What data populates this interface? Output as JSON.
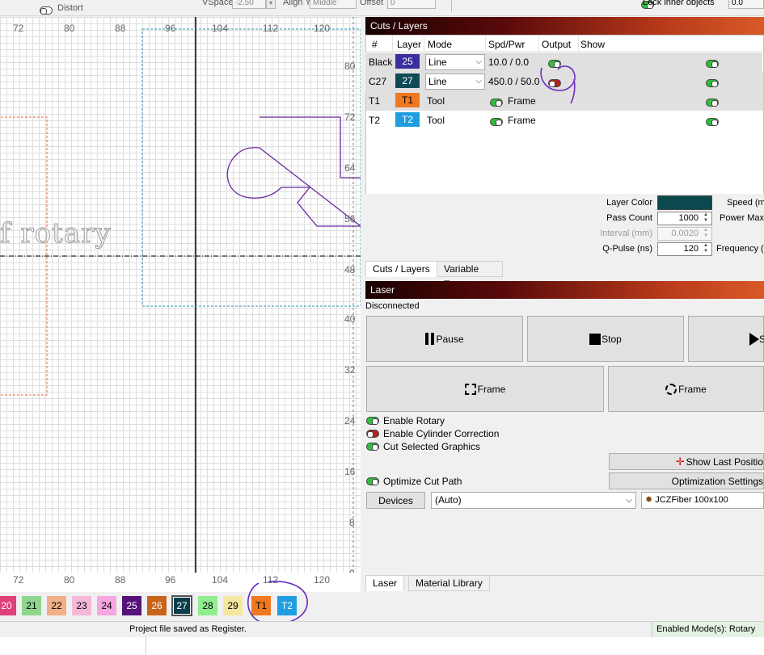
{
  "toolbar": {
    "distort_label": "Distort",
    "vspace_label": "VSpace",
    "vspace_value": "-2.50",
    "aligny_label": "Align Y",
    "aligny_value": "Middle",
    "offset_label": "Offset",
    "offset_value": "0",
    "lock_inner_label": "Lock inner objects",
    "right_value": "0.0"
  },
  "canvas": {
    "ruler_top": [
      "72",
      "80",
      "88",
      "96",
      "104",
      "112",
      "120"
    ],
    "ruler_bottom": [
      "72",
      "80",
      "88",
      "96",
      "104",
      "112",
      "120"
    ],
    "ruler_right": [
      "80",
      "72",
      "64",
      "56",
      "48",
      "40",
      "32",
      "24",
      "16",
      "8",
      "0"
    ],
    "text_object": "rotary"
  },
  "cuts_layers": {
    "title": "Cuts / Layers",
    "columns": [
      "#",
      "Layer",
      "Mode",
      "Spd/Pwr",
      "Output",
      "Show"
    ],
    "rows": [
      {
        "name": "Black",
        "layer": "25",
        "color": "#3a2f9e",
        "mode": "Line",
        "spdpwr": "10.0 / 0.0",
        "output": "on",
        "show": "on"
      },
      {
        "name": "C27",
        "layer": "27",
        "color": "#0f4a57",
        "mode": "Line",
        "spdpwr": "450.0 / 50.0",
        "output": "off",
        "show": "on"
      },
      {
        "name": "T1",
        "layer": "T1",
        "color": "#f07820",
        "mode": "Tool",
        "spdpwr": "Frame",
        "output": "",
        "show": "on"
      },
      {
        "name": "T2",
        "layer": "T2",
        "color": "#1e9de0",
        "mode": "Tool",
        "spdpwr": "Frame",
        "output": "",
        "show": "on"
      }
    ],
    "layer_color_label": "Layer Color",
    "layer_color": "#0a4a4f",
    "speed_label": "Speed (m",
    "pass_count_label": "Pass Count",
    "pass_count": "1000",
    "power_max_label": "Power Max",
    "interval_label": "Interval (mm)",
    "interval": "0.0020",
    "qpulse_label": "Q-Pulse (ns)",
    "qpulse": "120",
    "frequency_label": "Frequency (",
    "tabs": [
      "Cuts / Layers",
      "Variable Text"
    ]
  },
  "laser": {
    "title": "Laser",
    "status": "Disconnected",
    "pause_label": "Pause",
    "stop_label": "Stop",
    "start_label": "S",
    "frame_label": "Frame",
    "frame2_label": "Frame",
    "enable_rotary": "Enable Rotary",
    "enable_cylinder": "Enable Cylinder Correction",
    "cut_selected": "Cut Selected Graphics",
    "show_last_position": "Show Last Positio",
    "optimize_cut_path": "Optimize Cut Path",
    "optimization_settings": "Optimization Settings",
    "devices_label": "Devices",
    "device_select": "(Auto)",
    "device_name": "JCZFiber 100x100",
    "tabs": [
      "Laser",
      "Material Library"
    ]
  },
  "palette": [
    {
      "label": "20",
      "color": "#e0407a",
      "text": "#fff"
    },
    {
      "label": "21",
      "color": "#8ed68e",
      "text": "#000"
    },
    {
      "label": "22",
      "color": "#f0b088",
      "text": "#000"
    },
    {
      "label": "23",
      "color": "#f4b8d8",
      "text": "#000"
    },
    {
      "label": "24",
      "color": "#f6a6e0",
      "text": "#000"
    },
    {
      "label": "25",
      "color": "#55127a",
      "text": "#fff"
    },
    {
      "label": "26",
      "color": "#c8641a",
      "text": "#fff"
    },
    {
      "label": "27",
      "color": "#0a3e4a",
      "text": "#fff"
    },
    {
      "label": "28",
      "color": "#90ee90",
      "text": "#000"
    },
    {
      "label": "29",
      "color": "#f4e8a0",
      "text": "#000"
    },
    {
      "label": "T1",
      "color": "#f07820",
      "text": "#000"
    },
    {
      "label": "T2",
      "color": "#1e9de0",
      "text": "#fff"
    }
  ],
  "status_bar": {
    "message": "Project file saved as Register.",
    "modes": "Enabled Mode(s): Rotary"
  }
}
